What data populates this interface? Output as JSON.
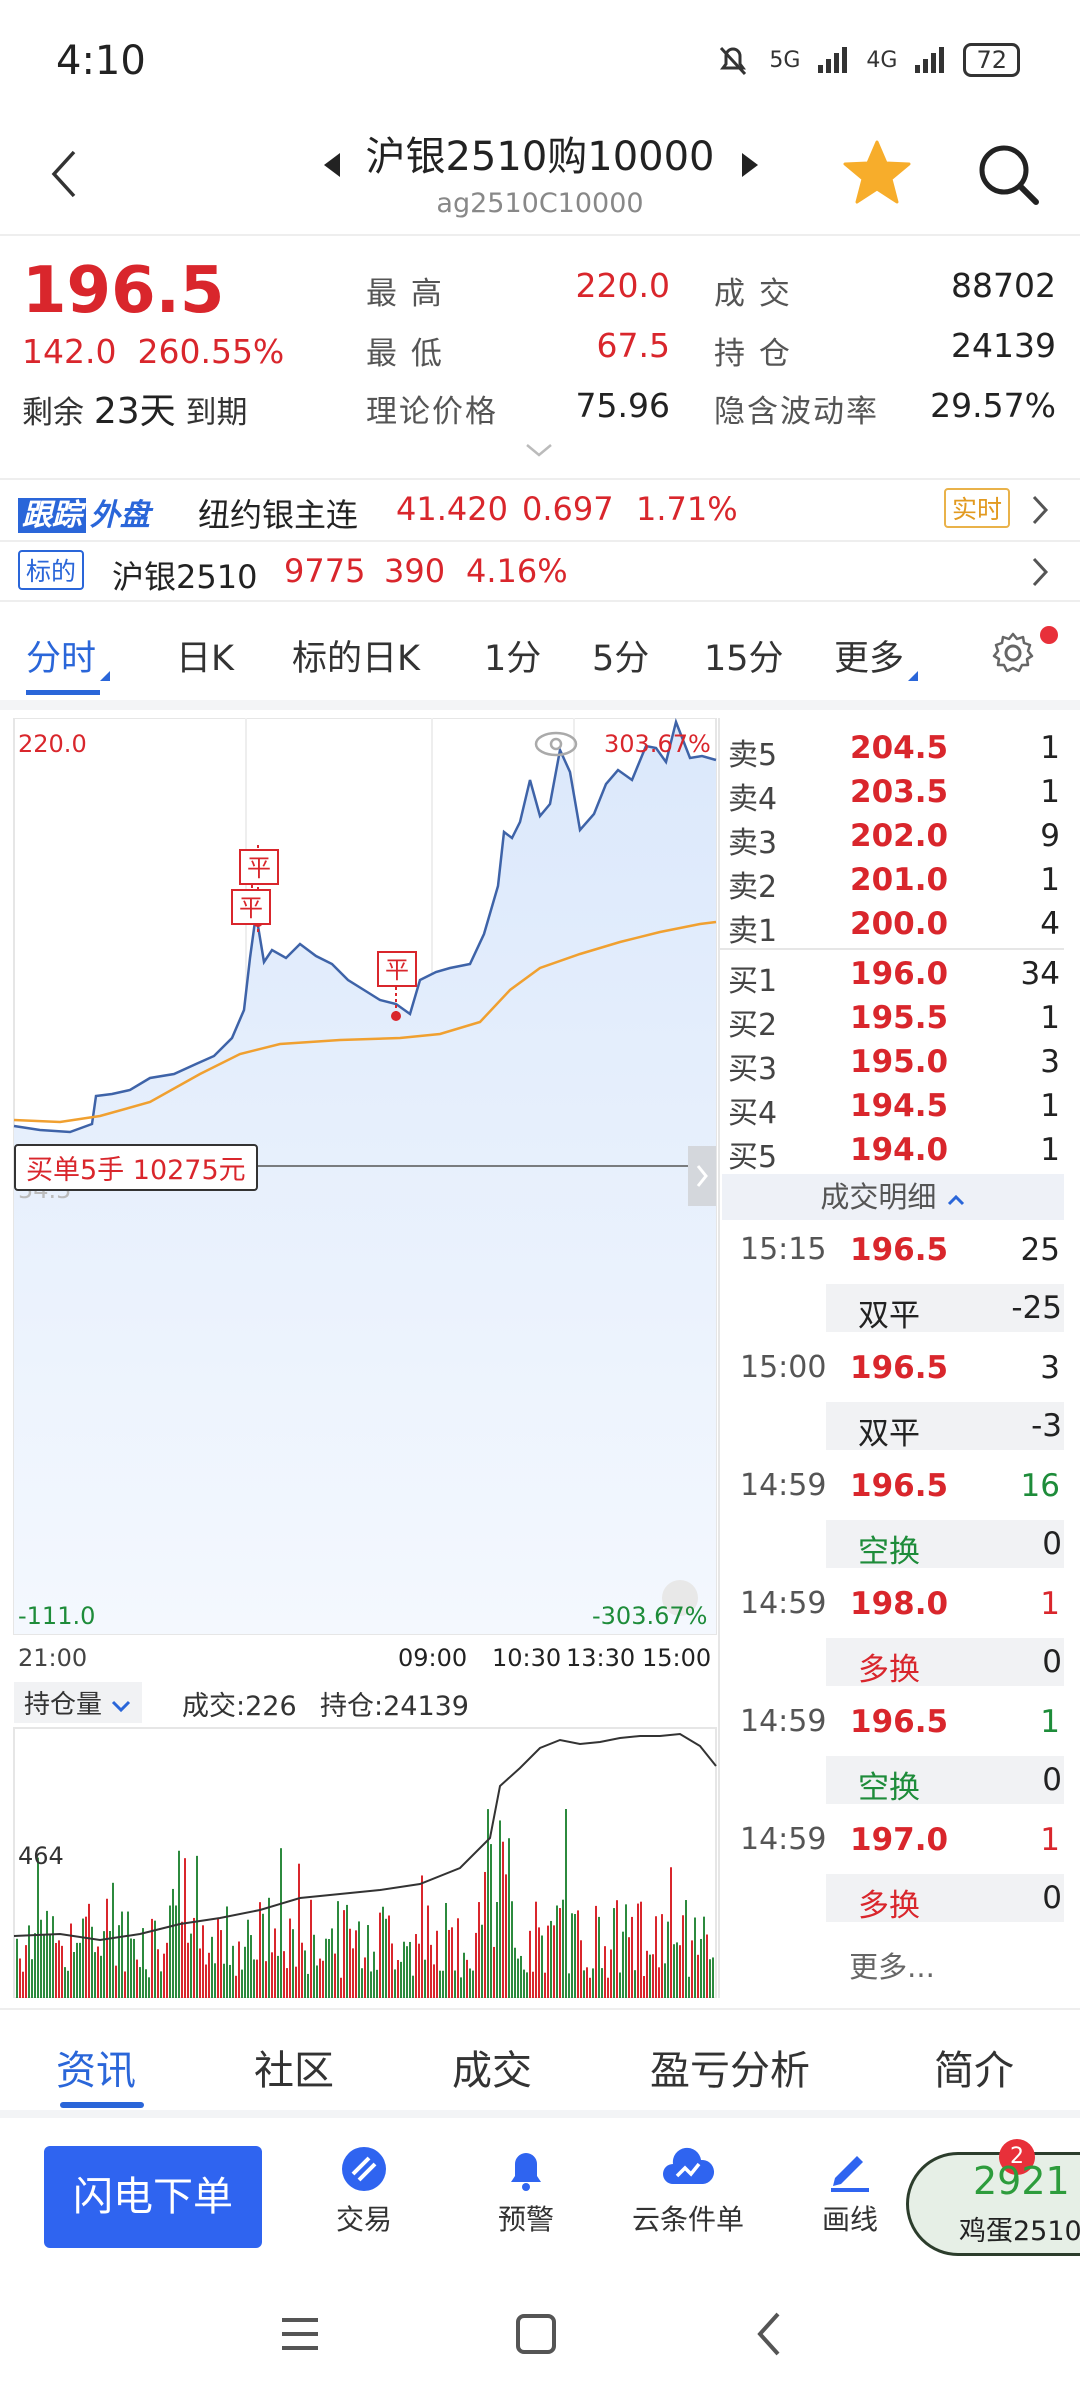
{
  "status": {
    "time": "4:10",
    "net1": "5G",
    "net2": "4G",
    "battery": "72"
  },
  "header": {
    "title": "沪银2510购10000",
    "code": "ag2510C10000"
  },
  "quote": {
    "price": "196.5",
    "change": "142.0",
    "change_pct": "260.55%",
    "remain_prefix": "剩余",
    "remain_days": "23天",
    "remain_suffix": "到期",
    "high_label": "最 高",
    "high": "220.0",
    "low_label": "最 低",
    "low": "67.5",
    "theory_label": "理论价格",
    "theory": "75.96",
    "volume_label": "成 交",
    "volume": "88702",
    "oi_label": "持 仓",
    "oi": "24139",
    "iv_label": "隐含波动率",
    "iv": "29.57%"
  },
  "follow_row": {
    "tag1": "跟踪",
    "tag2": "外盘",
    "name": "纽约银主连",
    "price": "41.420",
    "change": "0.697",
    "pct": "1.71%",
    "realtime": "实时"
  },
  "underlying_row": {
    "tag": "标的",
    "name": "沪银2510",
    "price": "9775",
    "change": "390",
    "pct": "4.16%"
  },
  "tabs": [
    "分时",
    "日K",
    "标的日K",
    "1分",
    "5分",
    "15分",
    "更多"
  ],
  "chart": {
    "y_top": "220.0",
    "y_top_pct": "303.67%",
    "y_bottom": "-111.0",
    "y_bottom_pct": "-303.67%",
    "ref_label": "54.5",
    "flat_marks": [
      "平",
      "平",
      "平"
    ],
    "times": [
      "21:00",
      "09:00",
      "10:30",
      "13:30",
      "15:00"
    ],
    "order_tag": "买单5手  10275元",
    "indicator": "持仓量",
    "vol_text": "成交:226",
    "oi_text": "持仓:24139",
    "vol_axis": "464"
  },
  "orderbook": {
    "asks": [
      {
        "label": "卖5",
        "price": "204.5",
        "vol": "1"
      },
      {
        "label": "卖4",
        "price": "203.5",
        "vol": "1"
      },
      {
        "label": "卖3",
        "price": "202.0",
        "vol": "9"
      },
      {
        "label": "卖2",
        "price": "201.0",
        "vol": "1"
      },
      {
        "label": "卖1",
        "price": "200.0",
        "vol": "4"
      }
    ],
    "bids": [
      {
        "label": "买1",
        "price": "196.0",
        "vol": "34"
      },
      {
        "label": "买2",
        "price": "195.5",
        "vol": "1"
      },
      {
        "label": "买3",
        "price": "195.0",
        "vol": "3"
      },
      {
        "label": "买4",
        "price": "194.5",
        "vol": "1"
      },
      {
        "label": "买5",
        "price": "194.0",
        "vol": "1"
      }
    ],
    "deals_header": "成交明细",
    "deals": [
      {
        "time": "15:15",
        "price": "196.5",
        "vol": "25",
        "vol_color": "black",
        "type": "双平",
        "type_color": "black",
        "type_vol": "-25"
      },
      {
        "time": "15:00",
        "price": "196.5",
        "vol": "3",
        "vol_color": "black",
        "type": "双平",
        "type_color": "black",
        "type_vol": "-3"
      },
      {
        "time": "14:59",
        "price": "196.5",
        "vol": "16",
        "vol_color": "green",
        "type": "空换",
        "type_color": "green",
        "type_vol": "0"
      },
      {
        "time": "14:59",
        "price": "198.0",
        "vol": "1",
        "vol_color": "red",
        "type": "多换",
        "type_color": "red",
        "type_vol": "0"
      },
      {
        "time": "14:59",
        "price": "196.5",
        "vol": "1",
        "vol_color": "green",
        "type": "空换",
        "type_color": "green",
        "type_vol": "0"
      },
      {
        "time": "14:59",
        "price": "197.0",
        "vol": "1",
        "vol_color": "red",
        "type": "多换",
        "type_color": "red",
        "type_vol": "0"
      }
    ],
    "more": "更多..."
  },
  "bottom_tabs": [
    "资讯",
    "社区",
    "成交",
    "盈亏分析",
    "简介"
  ],
  "actions": {
    "flash": "闪电下单",
    "trade": "交易",
    "alert": "预警",
    "cloud": "云条件单",
    "draw": "画线",
    "egg_num": "2921",
    "egg_name": "鸡蛋2510",
    "egg_badge": "2"
  },
  "colors": {
    "accent": "#2a66d9",
    "up": "#d9262c",
    "down": "#1e8c3a",
    "avg_line": "#f0a030"
  }
}
